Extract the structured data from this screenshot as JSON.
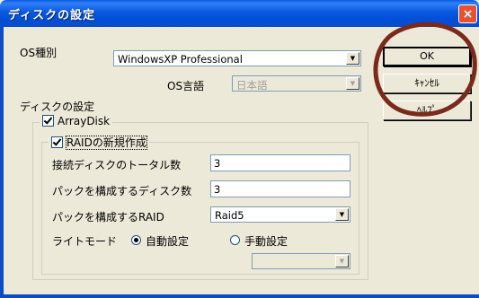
{
  "window": {
    "title": "ディスクの設定",
    "close_label": "×"
  },
  "os": {
    "type_label": "OS種別",
    "type_value": "WindowsXP Professional",
    "lang_label": "OS言語",
    "lang_value": "日本語"
  },
  "disk_settings_label": "ディスクの設定",
  "array_disk": {
    "label": "ArrayDisk",
    "checked": true
  },
  "raid_new": {
    "label": "RAIDの新規作成",
    "checked": true,
    "total_disks_label": "接続ディスクのトータル数",
    "total_disks_value": "3",
    "pack_disks_label": "パックを構成するディスク数",
    "pack_disks_value": "3",
    "pack_raid_label": "パックを構成するRAID",
    "pack_raid_value": "Raid5",
    "write_mode_label": "ライトモード",
    "auto_label": "自動設定",
    "manual_label": "手動設定",
    "selected_mode": "自動設定",
    "manual_value": ""
  },
  "buttons": {
    "ok": "OK",
    "cancel": "ｷｬﾝｾﾙ",
    "help": "ﾍﾙﾌﾟ"
  },
  "colors": {
    "title_bar": "#0a5ae0",
    "window_bg": "#ece9d8",
    "close_btn": "#e45230",
    "annotation": "#7a2a1c"
  }
}
